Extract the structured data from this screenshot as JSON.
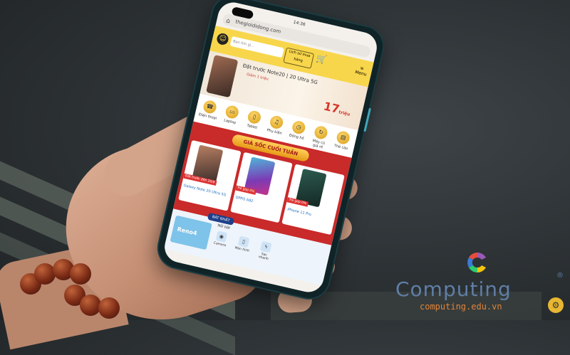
{
  "phone": {
    "status_time": "14:36",
    "url": "thegioididong.com",
    "search_placeholder": "Bạn tìm gì...",
    "order_button": "Lịch sử mua hàng",
    "menu_label": "Menu",
    "banner_title": "Đặt trước Note20 | 20 Ultra 5G",
    "banner_subtitle": "Giảm 1 triệu",
    "banner_price": "17",
    "banner_price_unit": "triệu",
    "categories": [
      {
        "label": "Điện thoại"
      },
      {
        "label": "Laptop"
      },
      {
        "label": "Tablet"
      },
      {
        "label": "Phụ kiện"
      },
      {
        "label": "Đồng hồ"
      },
      {
        "label": "Máy cũ giá rẻ"
      },
      {
        "label": "Thẻ cào"
      }
    ],
    "deal_title": "GIÁ SỐC CUỐI TUẦN",
    "products": [
      {
        "tag": "Đặt trước đến 20/8",
        "name": "Galaxy Note 20 Ultra 5G"
      },
      {
        "tag": "Trả góp 0%",
        "name": "OPPO A92"
      },
      {
        "tag": "Trả góp 0%",
        "name": "iPhone 11 Pro"
      }
    ],
    "product_brand_text": "OPPO A92",
    "featured_tag": "BÁT NHẤT",
    "featured_title": "Nổi bật",
    "featured_phone": "Reno4",
    "featured_items": [
      {
        "label": "Camera"
      },
      {
        "label": "Màn hình"
      },
      {
        "label": "Sạc nhanh"
      }
    ]
  },
  "watermark": {
    "brand": "Computing",
    "registered": "®",
    "url": "computing.edu.vn",
    "colors": {
      "brand": "#5f7ea5",
      "url": "#e0843c"
    }
  }
}
